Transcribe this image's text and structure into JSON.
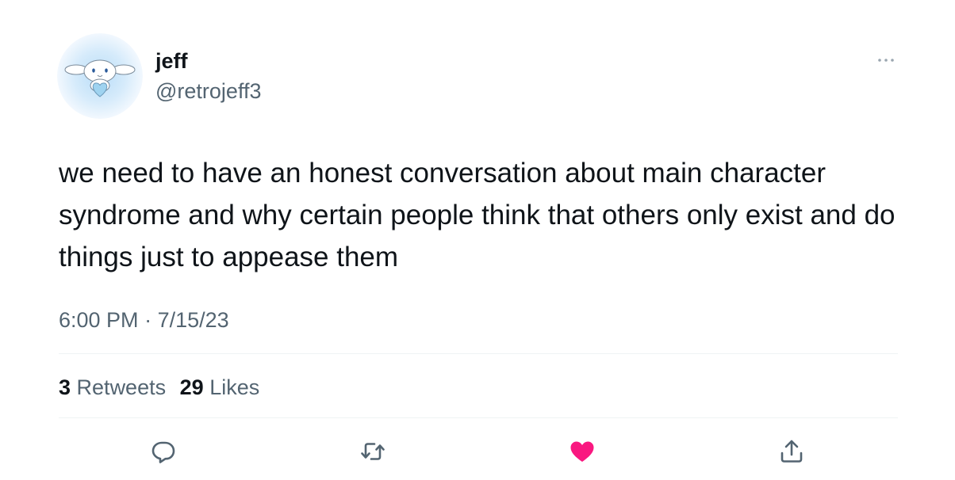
{
  "tweet": {
    "author": {
      "display_name": "jeff",
      "handle": "@retrojeff3",
      "avatar_icon": "cinnamoroll-heart-avatar"
    },
    "more_icon": "ellipsis-icon",
    "text": "we need to have an honest conversation about main character syndrome and why certain people think that others only exist and do things just to appease them",
    "time": "6:00 PM",
    "separator": "·",
    "date": "7/15/23",
    "stats": {
      "retweets_count": "3",
      "retweets_label": "Retweets",
      "likes_count": "29",
      "likes_label": "Likes"
    },
    "actions": [
      {
        "name": "reply",
        "icon": "reply-icon"
      },
      {
        "name": "retweet",
        "icon": "retweet-icon"
      },
      {
        "name": "like",
        "icon": "heart-icon",
        "active": true
      },
      {
        "name": "share",
        "icon": "share-icon"
      }
    ]
  },
  "colors": {
    "text_primary": "#0f1419",
    "text_secondary": "#536471",
    "divider": "#eff3f4",
    "like_active": "#f91880",
    "avatar_bg": "#d9ecfb"
  }
}
